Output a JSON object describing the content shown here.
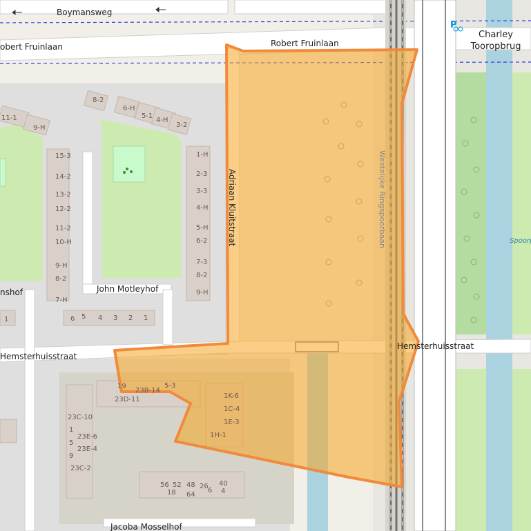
{
  "map": {
    "streets": {
      "boymansweg": "Boymansweg",
      "robert_fruinlaan_left": "obert Fruinlaan",
      "robert_fruinlaan_right": "Robert Fruinlaan",
      "adriaan_kluitstraat": "Adriaan Kluitstraat",
      "westelijke_ringspoorbaan": "Westelijke Ringspoorbaan",
      "hemsterhuisstraat_left": "Hemsterhuisstraat",
      "hemsterhuisstraat_right": "Hemsterhuisstraat",
      "john_motleyhof": "John Motleyhof",
      "jacoba_mosselhof": "Jacoba Mosselhof",
      "nshof": "nshof",
      "spoor": "Spoorp"
    },
    "poi": {
      "bridge_line1": "Charley",
      "bridge_line2": "Tooropbrug"
    },
    "house_numbers": {
      "top_row": [
        "8-2",
        "6-H",
        "5-1",
        "4-H",
        "3-2"
      ],
      "left_top": [
        "11-1",
        "9-H"
      ],
      "left_col": [
        "15-3",
        "14-2",
        "13-2",
        "12-2",
        "11-2",
        "10-H",
        "9-H",
        "8-2",
        "7-H"
      ],
      "right_col": [
        "1-H",
        "2-3",
        "3-3",
        "4-H",
        "5-H",
        "6-2",
        "7-3",
        "8-2",
        "9-H"
      ],
      "bottom_row": [
        "6",
        "5",
        "4",
        "3",
        "2",
        "1"
      ],
      "far_left": "1",
      "block_a": [
        "19",
        "23B-14",
        "5-3",
        "23D-11"
      ],
      "block_b": [
        "1K-6",
        "1C-4",
        "1E-3",
        "1H-1"
      ],
      "block_c": [
        "23C-10",
        "1",
        "23E-6",
        "5",
        "23E-4",
        "9",
        "23C-2"
      ],
      "block_d": [
        "56",
        "52",
        "48",
        "26",
        "40",
        "18",
        "64",
        "6",
        "4"
      ]
    },
    "colors": {
      "background": "#f2efe9",
      "road": "#ffffff",
      "park": "#c8facc",
      "grass": "#cdebb0",
      "water": "#aad3df",
      "railway": "#707070",
      "highlight_fill": "#f5a623",
      "highlight_stroke": "#f08a3c",
      "route_blue": "#2c3fd9"
    }
  }
}
